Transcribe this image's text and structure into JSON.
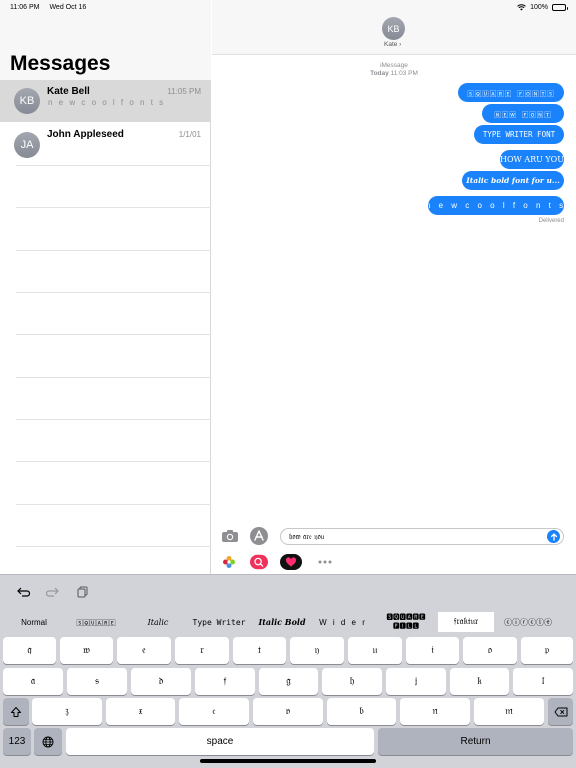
{
  "status": {
    "time": "11:06 PM",
    "date": "Wed Oct 16",
    "battery": "100%"
  },
  "sidebar": {
    "title": "Messages",
    "conversations": [
      {
        "initials": "KB",
        "name": "Kate Bell",
        "time": "11:05 PM",
        "preview": "n e w c o o l  f o n t s"
      },
      {
        "initials": "JA",
        "name": "John Appleseed",
        "time": "1/1/01",
        "preview": ""
      }
    ]
  },
  "chat": {
    "initials": "KB",
    "contact": "Kate ›",
    "service": "iMessage",
    "timestamp_day": "Today",
    "timestamp_time": "11:03 PM",
    "messages": [
      "🅂🅀🅄🄰🅁🄴 🄵🄾🄽🅃🅂",
      "🄽🄴🅆 🄵🄾🄽🅃",
      "TYPE WRITER FONT",
      "HOW ARU YOU",
      "Italic bold font for u...",
      "n e w  c o o l  f o n t s"
    ],
    "delivered": "Delivered",
    "input_value": "𝔥𝔬𝔴 𝔞𝔯𝔢 𝔶𝔬𝔲"
  },
  "keyboard": {
    "fonts": [
      "Normal",
      "🅂🅀🅄🄰🅁🄴",
      "Italic",
      "Type Writer",
      "Italic Bold",
      "W i d e r",
      "🆂🆀🆄🅰🆁🅴 🅵🅸🅻🅻",
      "𝔣𝔯𝔞𝔨𝔱𝔲𝔯",
      "ⓒⓘⓡⓒⓛⓔ"
    ],
    "row1": [
      "𝔮",
      "𝔴",
      "𝔢",
      "𝔯",
      "𝔱",
      "𝔶",
      "𝔲",
      "𝔦",
      "𝔬",
      "𝔭"
    ],
    "row2": [
      "𝔞",
      "𝔰",
      "𝔡",
      "𝔣",
      "𝔤",
      "𝔥",
      "𝔧",
      "𝔨",
      "𝔩"
    ],
    "row3": [
      "𝔷",
      "𝔵",
      "𝔠",
      "𝔳",
      "𝔟",
      "𝔫",
      "𝔪"
    ],
    "numbers": "123",
    "space": "space",
    "return": "Return"
  }
}
